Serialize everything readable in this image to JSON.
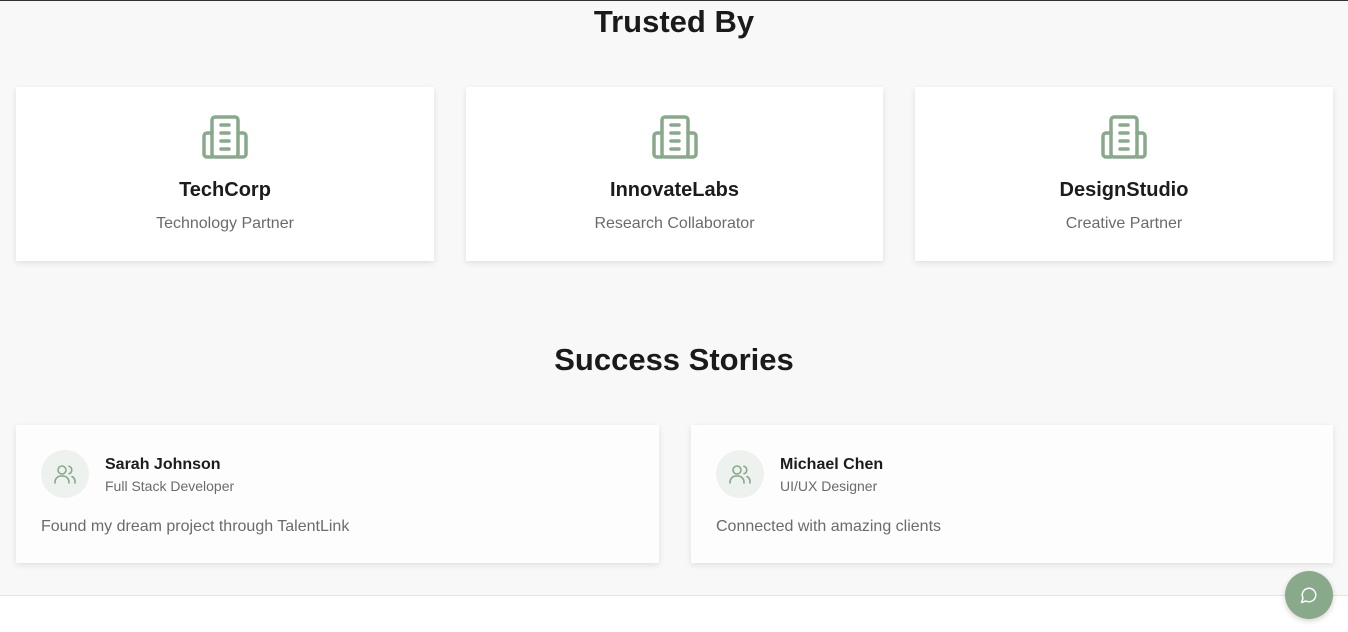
{
  "trusted": {
    "title": "Trusted By",
    "partners": [
      {
        "name": "TechCorp",
        "role": "Technology Partner",
        "icon": "building-icon"
      },
      {
        "name": "InnovateLabs",
        "role": "Research Collaborator",
        "icon": "building-icon"
      },
      {
        "name": "DesignStudio",
        "role": "Creative Partner",
        "icon": "building-icon"
      }
    ]
  },
  "stories": {
    "title": "Success Stories",
    "items": [
      {
        "name": "Sarah Johnson",
        "title": "Full Stack Developer",
        "quote": "Found my dream project through TalentLink",
        "icon": "users-icon"
      },
      {
        "name": "Michael Chen",
        "title": "UI/UX Designer",
        "quote": "Connected with amazing clients",
        "icon": "users-icon"
      }
    ]
  },
  "chat": {
    "icon": "chat-bubble-icon"
  },
  "colors": {
    "accent": "#88a98a",
    "background": "#f8f8f8",
    "card": "#ffffff",
    "muted_text": "#6b6b6b"
  }
}
